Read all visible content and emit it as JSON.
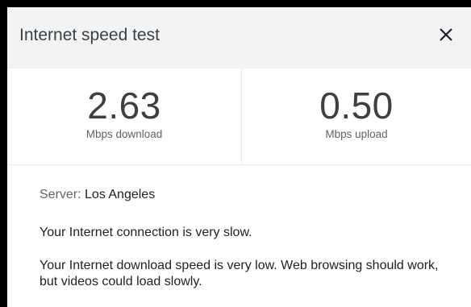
{
  "header": {
    "title": "Internet speed test",
    "close_icon": "close-icon"
  },
  "results": {
    "download": {
      "value": "2.63",
      "label": "Mbps download"
    },
    "upload": {
      "value": "0.50",
      "label": "Mbps upload"
    }
  },
  "details": {
    "server_prefix": "Server: ",
    "server_name": "Los Angeles",
    "status": "Your Internet connection is very slow.",
    "description": "Your Internet download speed is very low. Web browsing should work, but videos could load slowly."
  }
}
